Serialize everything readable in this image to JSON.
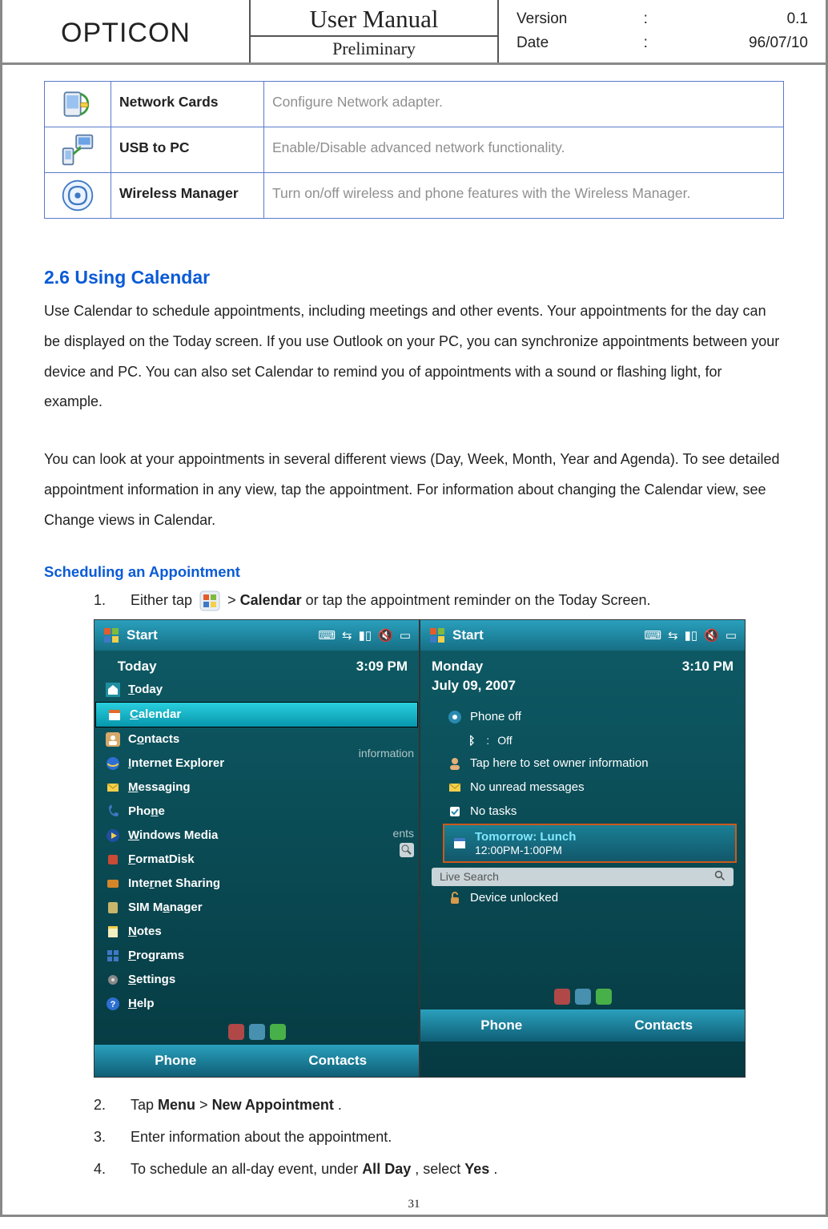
{
  "header": {
    "brand": "OPTICON",
    "title": "User Manual",
    "subtitle": "Preliminary",
    "version_label": "Version",
    "version_value": "0.1",
    "date_label": "Date",
    "date_value": "96/07/10"
  },
  "features": [
    {
      "icon": "network-cards-icon",
      "name": "Network Cards",
      "desc": "Configure Network adapter."
    },
    {
      "icon": "usb-to-pc-icon",
      "name": "USB to PC",
      "desc": "Enable/Disable advanced network functionality."
    },
    {
      "icon": "wireless-manager-icon",
      "name": "Wireless Manager",
      "desc": "Turn on/off wireless and phone features with the Wireless Manager."
    }
  ],
  "section": {
    "title": "2.6 Using Calendar",
    "para1": "Use Calendar to schedule appointments, including meetings and other events. Your appointments for the day can be displayed on the Today screen. If you use Outlook on your PC, you can synchronize appointments between your device and PC. You can also set Calendar to remind you of appointments with a sound or flashing light, for example.",
    "para2": "You can look at your appointments in several different views (Day, Week, Month, Year and Agenda). To see detailed appointment information in any view, tap the appointment. For information about changing the Calendar view, see Change views in Calendar."
  },
  "subsection": {
    "title": "Scheduling an Appointment",
    "step1_a": "Either tap ",
    "step1_b": " > ",
    "step1_calendar": "Calendar",
    "step1_c": " or tap the appointment reminder on the Today Screen.",
    "step2_a": "Tap ",
    "step2_menu": "Menu",
    "step2_sep": " > ",
    "step2_new": "New Appointment",
    "step2_end": ".",
    "step3": "Enter information about the appointment.",
    "step4_a": "To schedule an all-day event, under ",
    "step4_allday": "All Day",
    "step4_b": ", select ",
    "step4_yes": "Yes",
    "step4_end": "."
  },
  "nums": {
    "n1": "1.",
    "n2": "2.",
    "n3": "3.",
    "n4": "4."
  },
  "screenshots": {
    "left": {
      "start_label": "Start",
      "top_label": "Today",
      "time": "3:09 PM",
      "menu": [
        "Today",
        "Calendar",
        "Contacts",
        "Internet Explorer",
        "Messaging",
        "Phone",
        "Windows Media",
        "FormatDisk",
        "Internet Sharing",
        "SIM Manager",
        "Notes",
        "Programs",
        "Settings",
        "Help"
      ],
      "selected_index": 1,
      "cut1": "information",
      "cut2": "ents",
      "bottom_left": "Phone",
      "bottom_right": "Contacts"
    },
    "right": {
      "start_label": "Start",
      "top_label": "Monday",
      "date": "July 09, 2007",
      "time": "3:10 PM",
      "items": {
        "phone_off": "Phone off",
        "bt_off": "Off",
        "owner": "Tap here to set owner information",
        "msgs": "No unread messages",
        "tasks": "No tasks",
        "sel1": "Tomorrow: Lunch",
        "sel2": "12:00PM-1:00PM",
        "search": "Live Search",
        "unlocked": "Device unlocked"
      },
      "bottom_left": "Phone",
      "bottom_right": "Contacts"
    }
  },
  "page_number": "31"
}
